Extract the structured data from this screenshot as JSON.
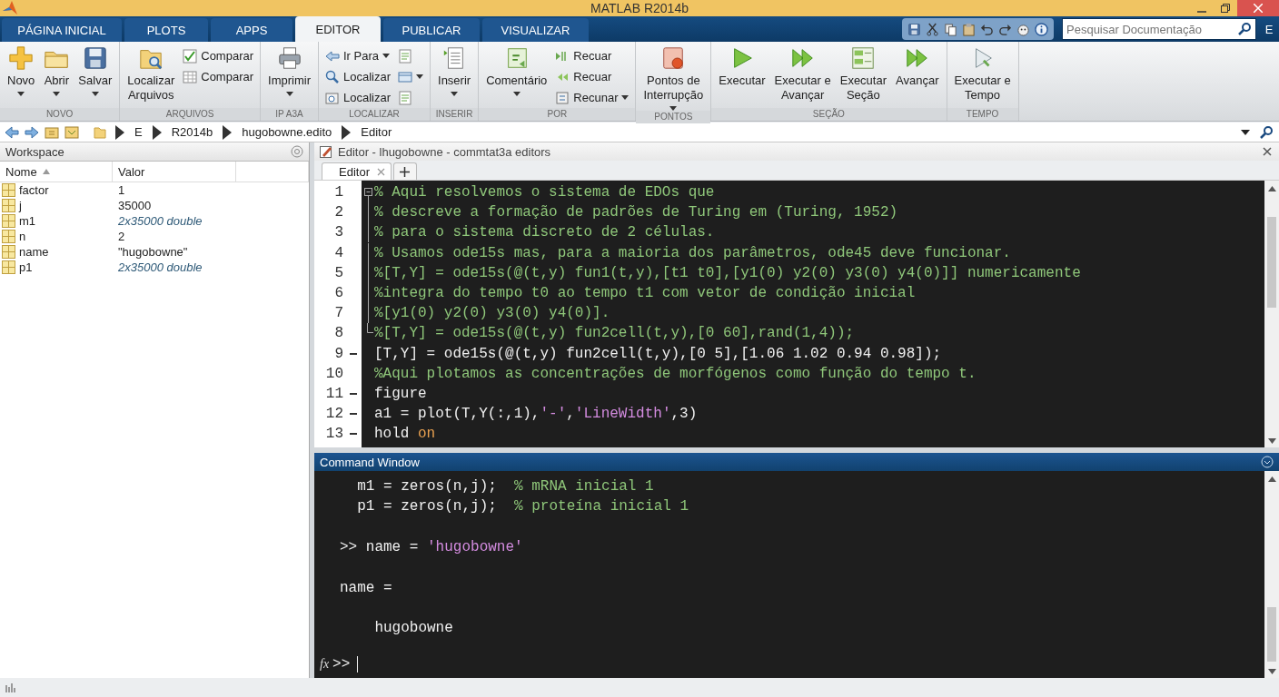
{
  "window": {
    "title": "MATLAB R2014b"
  },
  "tabs": [
    {
      "label": "PÁGINA INICIAL",
      "selected": false
    },
    {
      "label": "PLOTS",
      "selected": false
    },
    {
      "label": "APPS",
      "selected": false
    },
    {
      "label": "EDITOR",
      "selected": true
    },
    {
      "label": "PUBLICAR",
      "selected": false
    },
    {
      "label": "VISUALIZAR",
      "selected": false
    }
  ],
  "search": {
    "placeholder": "Pesquisar Documentação"
  },
  "help_menu_label": "E",
  "ribbon": [
    {
      "label": "NOVO",
      "items": [
        {
          "kind": "large",
          "label": "Novo",
          "dropdown": true
        },
        {
          "kind": "large",
          "label": "Abrir",
          "dropdown": true
        },
        {
          "kind": "large",
          "label": "Salvar",
          "dropdown": true
        }
      ]
    },
    {
      "label": "ARQUIVOS",
      "items": [
        {
          "kind": "large",
          "label": "Localizar\nArquivos",
          "dropdown": false
        },
        {
          "kind": "stack",
          "entries": [
            {
              "label": "Comparar",
              "dropdown": false
            },
            {
              "label": "Comparar",
              "dropdown": false
            }
          ]
        }
      ]
    },
    {
      "label": "IP A3A",
      "items": [
        {
          "kind": "large",
          "label": "Imprimir",
          "dropdown": true
        }
      ]
    },
    {
      "label": "LOCALIZAR",
      "items": [
        {
          "kind": "stack",
          "entries": [
            {
              "label": "Ir Para",
              "dropdown": true
            },
            {
              "label": "Localizar",
              "dropdown": false
            },
            {
              "label": "Localizar",
              "dropdown": false
            }
          ]
        },
        {
          "kind": "icons",
          "entries": [
            {
              "dropdown": false
            },
            {
              "dropdown": true
            },
            {
              "dropdown": false
            }
          ]
        }
      ]
    },
    {
      "label": "INSERIR",
      "items": [
        {
          "kind": "large",
          "label": "Inserir",
          "dropdown": true
        }
      ]
    },
    {
      "label": "POR",
      "items": [
        {
          "kind": "large",
          "label": "Comentário",
          "dropdown": true
        },
        {
          "kind": "stack",
          "entries": [
            {
              "label": "Recuar",
              "dropdown": false
            },
            {
              "label": "Recuar",
              "dropdown": false
            },
            {
              "label": "Recunar",
              "dropdown": true
            }
          ]
        }
      ]
    },
    {
      "label": "PONTOS",
      "items": [
        {
          "kind": "large",
          "label": "Pontos de\nInterrupção",
          "dropdown": true
        }
      ]
    },
    {
      "label": "SEÇÃO",
      "items": [
        {
          "kind": "large",
          "label": "Executar",
          "dropdown": false
        },
        {
          "kind": "large",
          "label": "Executar e\nAvançar",
          "dropdown": false
        },
        {
          "kind": "large",
          "label": "Executar\nSeção",
          "dropdown": false
        },
        {
          "kind": "large",
          "label": "Avançar",
          "dropdown": false
        }
      ]
    },
    {
      "label": "TEMPO",
      "items": [
        {
          "kind": "large",
          "label": "Executar e\nTempo",
          "dropdown": false
        }
      ]
    }
  ],
  "path": [
    "E",
    "R2014b",
    "hugobowne.edito",
    "Editor"
  ],
  "workspace": {
    "title": "Workspace",
    "columns": [
      {
        "label": "Nome",
        "sorted": true
      },
      {
        "label": "Valor",
        "sorted": false
      }
    ],
    "rows": [
      {
        "name": "factor",
        "value": "1",
        "kind": "scalar"
      },
      {
        "name": "j",
        "value": "35000",
        "kind": "scalar"
      },
      {
        "name": "m1",
        "value": "2x35000 double",
        "kind": "array"
      },
      {
        "name": "n",
        "value": "2",
        "kind": "scalar"
      },
      {
        "name": "name",
        "value": "\"hugobowne\"",
        "kind": "scalar"
      },
      {
        "name": "p1",
        "value": "2x35000 double",
        "kind": "array"
      }
    ]
  },
  "editor": {
    "title": "Editor - lhugobowne - commtat3a editors",
    "tabs": [
      {
        "label": "Editor",
        "selected": true
      }
    ],
    "lines": [
      {
        "number": "1",
        "executable": false,
        "fold": true,
        "segments": [
          {
            "kind": "comment",
            "text": "% Aqui resolvemos o sistema de EDOs que"
          }
        ]
      },
      {
        "number": "2",
        "executable": false,
        "fold": true,
        "segments": [
          {
            "kind": "comment",
            "text": "% descreve a formação de padrões de Turing em (Turing, 1952)"
          }
        ]
      },
      {
        "number": "3",
        "executable": false,
        "fold": true,
        "segments": [
          {
            "kind": "comment",
            "text": "% para o sistema discreto de 2 células."
          }
        ]
      },
      {
        "number": "4",
        "executable": false,
        "fold": true,
        "segments": [
          {
            "kind": "comment",
            "text": "% Usamos ode15s mas, para a maioria dos parâmetros, ode45 deve funcionar."
          }
        ]
      },
      {
        "number": "5",
        "executable": false,
        "fold": true,
        "segments": [
          {
            "kind": "comment",
            "text": "%[T,Y] = ode15s(@(t,y) fun1(t,y),[t1 t0],[y1(0) y2(0) y3(0) y4(0)]] numericamente"
          }
        ]
      },
      {
        "number": "6",
        "executable": false,
        "fold": true,
        "segments": [
          {
            "kind": "comment",
            "text": "%integra do tempo t0 ao tempo t1 com vetor de condição inicial"
          }
        ]
      },
      {
        "number": "7",
        "executable": false,
        "fold": true,
        "segments": [
          {
            "kind": "comment",
            "text": "%[y1(0) y2(0) y3(0) y4(0)]."
          }
        ]
      },
      {
        "number": "8",
        "executable": false,
        "fold": true,
        "segments": [
          {
            "kind": "comment",
            "text": "%[T,Y] = ode15s(@(t,y) fun2cell(t,y),[0 60],rand(1,4));"
          }
        ]
      },
      {
        "number": "9",
        "executable": true,
        "fold": false,
        "segments": [
          {
            "kind": "code",
            "text": "[T,Y] = ode15s(@(t,y) fun2cell(t,y),[0 5],[1.06 1.02 0.94 0.98]);"
          }
        ]
      },
      {
        "number": "10",
        "executable": false,
        "fold": false,
        "segments": [
          {
            "kind": "comment",
            "text": "%Aqui plotamos as concentrações de morfógenos como função do tempo t."
          }
        ]
      },
      {
        "number": "11",
        "executable": true,
        "fold": false,
        "segments": [
          {
            "kind": "code",
            "text": "figure"
          }
        ]
      },
      {
        "number": "12",
        "executable": true,
        "fold": false,
        "segments": [
          {
            "kind": "code",
            "text": "a1 = plot(T,Y(:,1),"
          },
          {
            "kind": "string",
            "text": "'-'"
          },
          {
            "kind": "code",
            "text": ","
          },
          {
            "kind": "string",
            "text": "'LineWidth'"
          },
          {
            "kind": "code",
            "text": ",3)"
          }
        ]
      },
      {
        "number": "13",
        "executable": true,
        "fold": false,
        "segments": [
          {
            "kind": "code",
            "text": "hold "
          },
          {
            "kind": "keyword",
            "text": "on"
          }
        ]
      }
    ]
  },
  "command_window": {
    "title": "Command Window",
    "lines": [
      {
        "kind": "text",
        "segments": [
          {
            "kind": "code",
            "text": "  m1 = zeros(n,j);  "
          },
          {
            "kind": "comment",
            "text": "% mRNA inicial 1"
          }
        ]
      },
      {
        "kind": "text",
        "segments": [
          {
            "kind": "code",
            "text": "  p1 = zeros(n,j);  "
          },
          {
            "kind": "comment",
            "text": "% proteína inicial 1"
          }
        ]
      },
      {
        "kind": "blank"
      },
      {
        "kind": "text",
        "segments": [
          {
            "kind": "code",
            "text": ">> name = "
          },
          {
            "kind": "string",
            "text": "'hugobowne'"
          }
        ]
      },
      {
        "kind": "blank"
      },
      {
        "kind": "text",
        "segments": [
          {
            "kind": "code",
            "text": "name ="
          }
        ]
      },
      {
        "kind": "blank"
      },
      {
        "kind": "text",
        "segments": [
          {
            "kind": "code",
            "text": "    hugobowne"
          }
        ]
      }
    ],
    "function_browser_label": "fx",
    "prompt": ">>"
  }
}
